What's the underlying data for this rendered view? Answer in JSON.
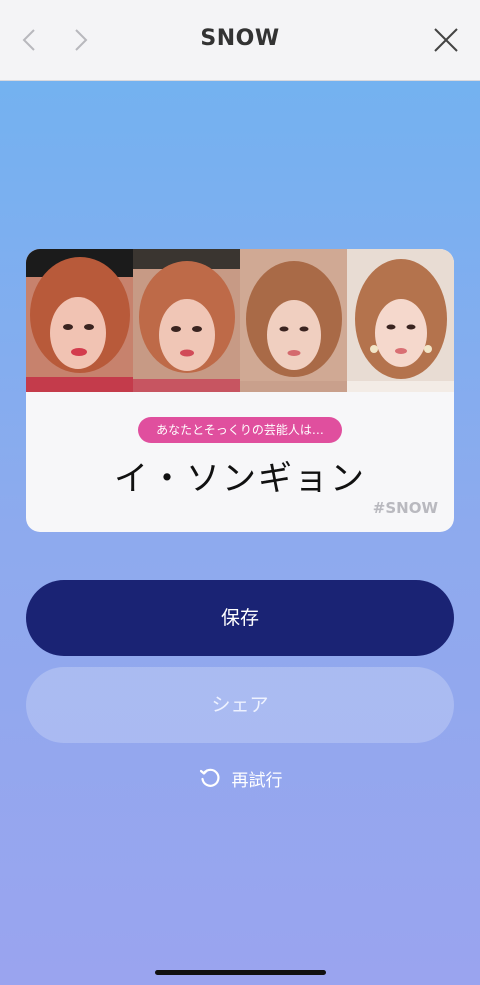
{
  "header": {
    "title": "SNOW"
  },
  "result": {
    "subtitle": "あなたとそっくりの芸能人は…",
    "celebrity_name": "イ・ソンギョン",
    "hashtag": "#SNOW"
  },
  "actions": {
    "save_label": "保存",
    "share_label": "シェア",
    "retry_label": "再試行"
  },
  "colors": {
    "accent_pink": "#e04f9e",
    "primary_button": "#1a2374"
  }
}
